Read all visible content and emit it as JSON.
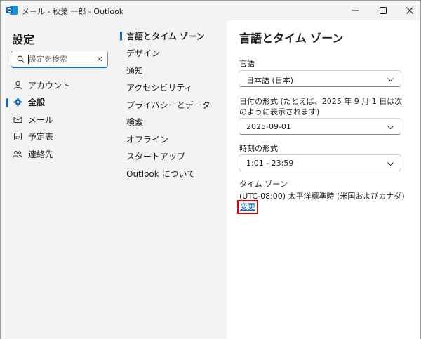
{
  "window": {
    "title": "メール - 秋葉 一郎 - Outlook",
    "app_icon": "outlook-icon"
  },
  "sidebar": {
    "title": "設定",
    "search": {
      "placeholder": "設定を検索",
      "value": ""
    },
    "items": [
      {
        "label": "アカウント",
        "icon": "person-icon"
      },
      {
        "label": "全般",
        "icon": "gear-icon",
        "active": true
      },
      {
        "label": "メール",
        "icon": "mail-icon"
      },
      {
        "label": "予定表",
        "icon": "calendar-icon"
      },
      {
        "label": "連絡先",
        "icon": "people-icon"
      }
    ]
  },
  "subnav": {
    "items": [
      {
        "label": "言語とタイム ゾーン",
        "active": true
      },
      {
        "label": "デザイン"
      },
      {
        "label": "通知"
      },
      {
        "label": "アクセシビリティ"
      },
      {
        "label": "プライバシーとデータ"
      },
      {
        "label": "検索"
      },
      {
        "label": "オフライン"
      },
      {
        "label": "スタートアップ"
      },
      {
        "label": "Outlook について"
      }
    ]
  },
  "panel": {
    "title": "言語とタイム ゾーン",
    "language": {
      "label": "言語",
      "value": "日本語 (日本)"
    },
    "date_format": {
      "label": "日付の形式 (たとえば、2025 年 9 月 1 日は次のように表示されます)",
      "value": "2025-09-01"
    },
    "time_format": {
      "label": "時刻の形式",
      "value": "1:01 - 23:59"
    },
    "time_zone": {
      "label": "タイム ゾーン",
      "value": "(UTC-08:00) 太平洋標準時 (米国およびカナダ)",
      "change_label": "変更"
    }
  },
  "colors": {
    "accent": "#0f6cbd",
    "highlight": "#e00000",
    "pane_bg": "#f3f3f3"
  }
}
